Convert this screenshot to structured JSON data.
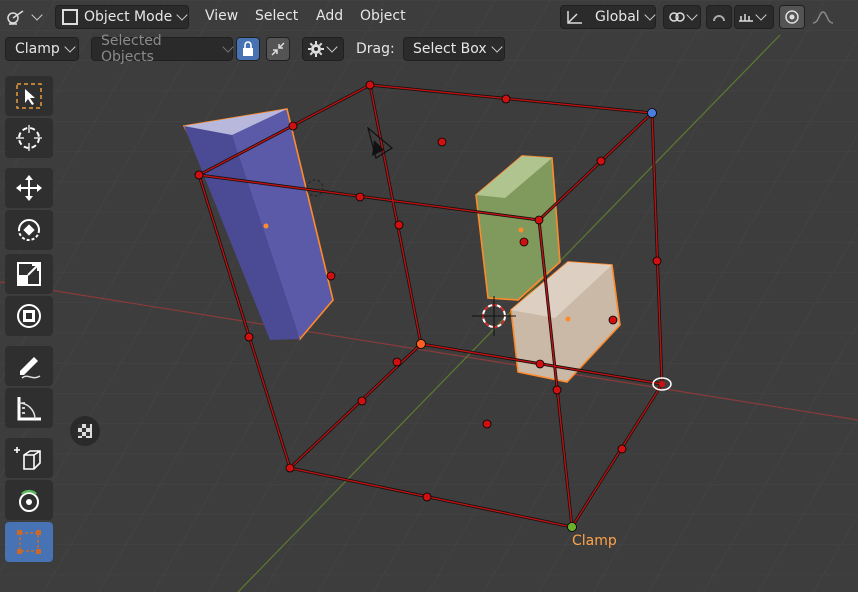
{
  "header": {
    "editor_icon": "scene-editor-icon",
    "mode": "Object Mode",
    "menu": [
      "View",
      "Select",
      "Add",
      "Object"
    ],
    "orientation": "Global",
    "orientation_icon": "transform-orientation-icon",
    "pivot_icon": "pivot-point-icon",
    "snap_icon": "snap-magnet-icon",
    "snap_increment_icon": "snap-increment-icon",
    "proportional_icon": "proportional-editing-icon",
    "falloff_icon": "falloff-curve-icon"
  },
  "toolbar": {
    "clamp_label": "Clamp",
    "selected_objects_label": "Selected Objects",
    "lock_icon": "lock-icon",
    "shrink_icon": "shrink-icon",
    "settings_icon": "gear-icon",
    "drag_label": "Drag:",
    "drag_value": "Select Box"
  },
  "tools": [
    "select-box-icon",
    "cursor-icon",
    "move-icon",
    "rotate-icon",
    "scale-icon",
    "transform-icon",
    "annotate-icon",
    "measure-icon",
    "add-cube-icon",
    "spin-icon",
    "cage-transform-icon"
  ],
  "viewport": {
    "gizmo_label": "Clamp",
    "checker_icon": "checker-icon"
  }
}
